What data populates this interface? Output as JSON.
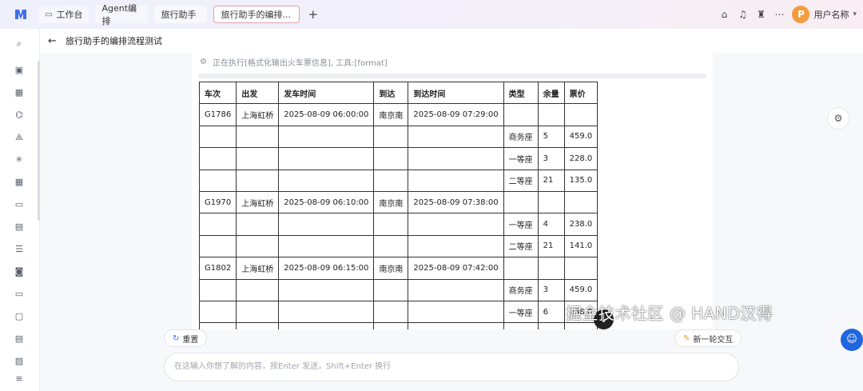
{
  "topbar": {
    "tabs": [
      {
        "label": "工作台",
        "icon": "monitor-icon"
      },
      {
        "label": "Agent编排"
      },
      {
        "label": "旅行助手"
      },
      {
        "label": "旅行助手的编排..."
      }
    ],
    "add_tab": "+",
    "user_initial": "P",
    "username": "用户名称"
  },
  "header": {
    "back": "←",
    "title": "旅行助手的编排流程测试"
  },
  "exec": {
    "text": "正在执行[格式化输出火车票信息], 工具:[format]"
  },
  "table": {
    "headers": [
      "车次",
      "出发",
      "发车时间",
      "到达",
      "到达时间",
      "类型",
      "余量",
      "票价"
    ],
    "rows": [
      [
        "G1786",
        "上海虹桥",
        "2025-08-09 06:00:00",
        "南京南",
        "2025-08-09 07:29:00",
        "",
        "",
        ""
      ],
      [
        "",
        "",
        "",
        "",
        "",
        "商务座",
        "5",
        "459.0"
      ],
      [
        "",
        "",
        "",
        "",
        "",
        "一等座",
        "3",
        "228.0"
      ],
      [
        "",
        "",
        "",
        "",
        "",
        "二等座",
        "21",
        "135.0"
      ],
      [
        "G1970",
        "上海虹桥",
        "2025-08-09 06:10:00",
        "南京南",
        "2025-08-09 07:38:00",
        "",
        "",
        ""
      ],
      [
        "",
        "",
        "",
        "",
        "",
        "一等座",
        "4",
        "238.0"
      ],
      [
        "",
        "",
        "",
        "",
        "",
        "二等座",
        "21",
        "141.0"
      ],
      [
        "G1802",
        "上海虹桥",
        "2025-08-09 06:15:00",
        "南京南",
        "2025-08-09 07:42:00",
        "",
        "",
        ""
      ],
      [
        "",
        "",
        "",
        "",
        "",
        "商务座",
        "3",
        "459.0"
      ],
      [
        "",
        "",
        "",
        "",
        "",
        "一等座",
        "6",
        "238.0"
      ],
      [
        "",
        "",
        "",
        "",
        "",
        "",
        "",
        ""
      ]
    ]
  },
  "actions": {
    "reset": "重置",
    "new_round": "新一轮交互"
  },
  "input": {
    "placeholder": "在这输入你想了解的内容，按Enter 发送，Shift+Enter 换行"
  },
  "watermark": "掘金技术社区 @ HAND汉得",
  "colors": {
    "accent": "#1f66e0",
    "avatar": "#f39b3f"
  }
}
